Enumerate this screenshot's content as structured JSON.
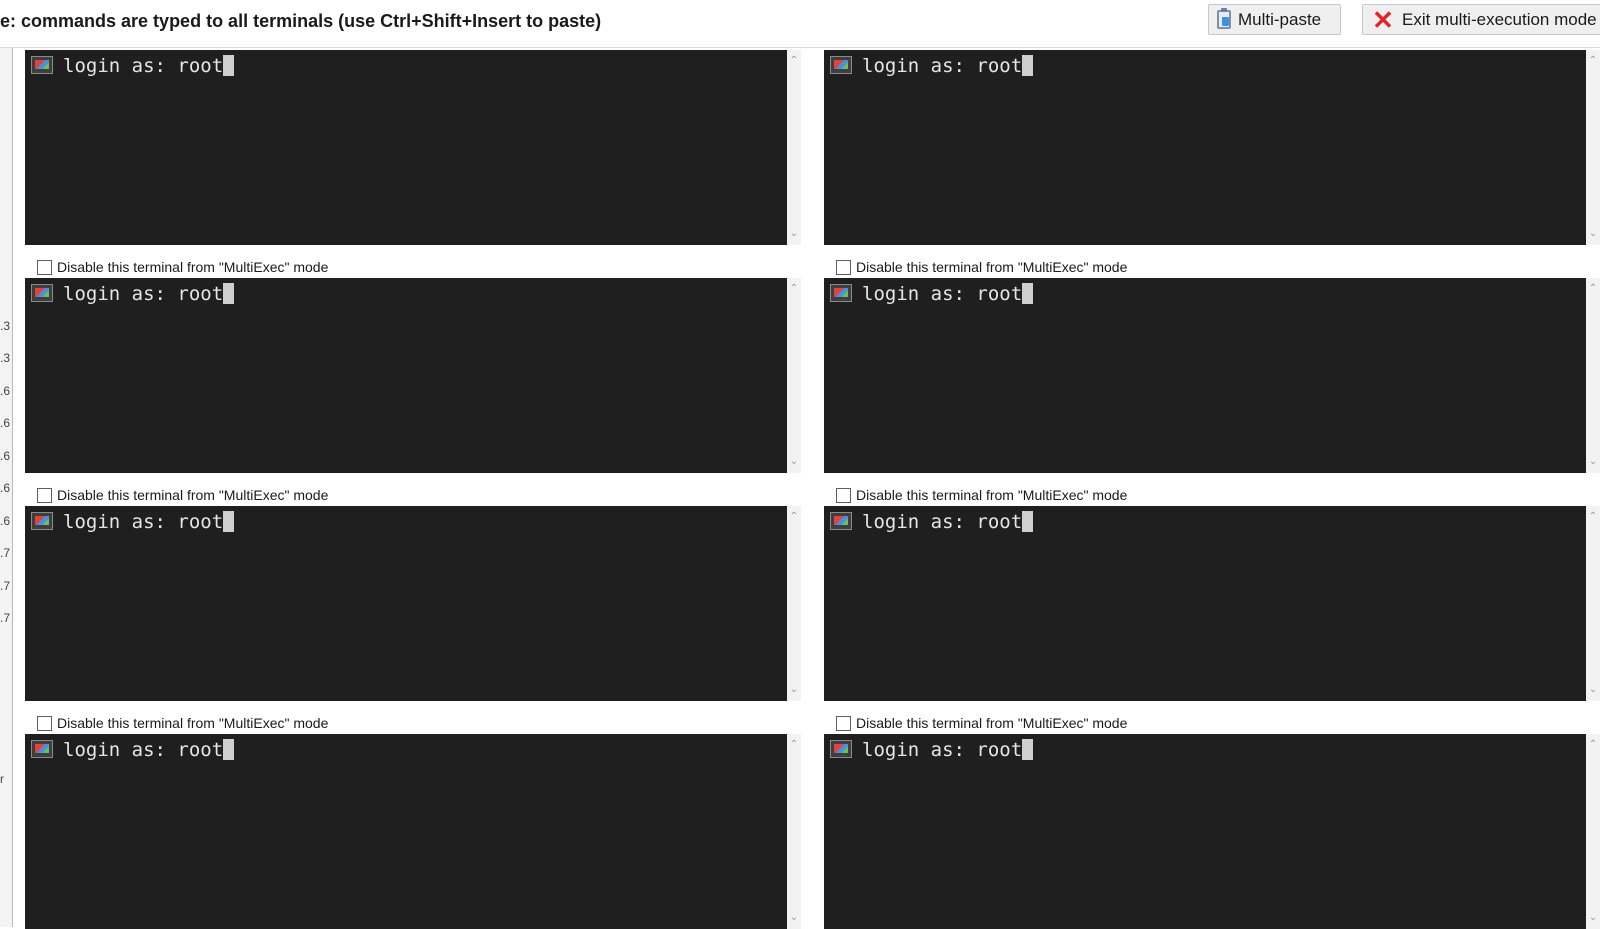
{
  "toolbar": {
    "banner": "e: commands are typed to all terminals (use Ctrl+Shift+Insert to paste)",
    "multi_paste": "Multi-paste",
    "exit": "Exit multi-execution mode"
  },
  "left_strip": [
    ".3",
    ".3",
    ".6",
    ".6",
    ".6",
    ".6",
    ".6",
    ".7",
    ".7",
    ".7",
    "r"
  ],
  "terminals": [
    {
      "prompt": "login as: root",
      "disable_label": "Disable this terminal from \"MultiExec\" mode"
    },
    {
      "prompt": "login as: root",
      "disable_label": "Disable this terminal from \"MultiExec\" mode"
    },
    {
      "prompt": "login as: root",
      "disable_label": "Disable this terminal from \"MultiExec\" mode"
    },
    {
      "prompt": "login as: root",
      "disable_label": "Disable this terminal from \"MultiExec\" mode"
    },
    {
      "prompt": "login as: root",
      "disable_label": "Disable this terminal from \"MultiExec\" mode"
    },
    {
      "prompt": "login as: root",
      "disable_label": "Disable this terminal from \"MultiExec\" mode"
    },
    {
      "prompt": "login as: root"
    },
    {
      "prompt": "login as: root"
    }
  ]
}
